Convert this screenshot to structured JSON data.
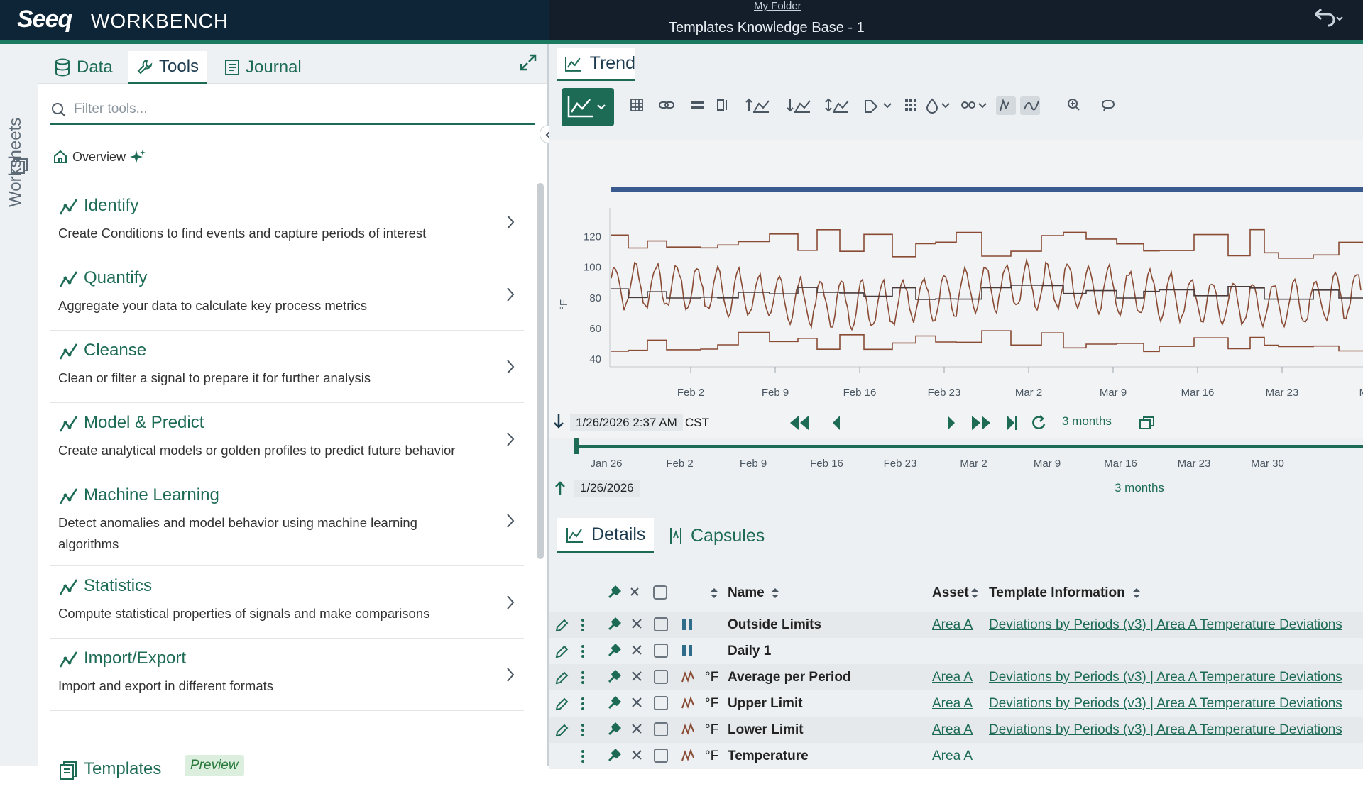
{
  "header": {
    "logo": "Seeq",
    "logo_sub": "WORKBENCH",
    "folder": "My Folder",
    "title": "Templates Knowledge Base - 1"
  },
  "rail": {
    "label": "Worksheets"
  },
  "left_tabs": {
    "data": "Data",
    "tools": "Tools",
    "journal": "Journal"
  },
  "filter": {
    "placeholder": "Filter tools..."
  },
  "overview": "Overview",
  "tools": [
    {
      "title": "Identify",
      "desc": "Create Conditions to find events and capture periods of interest",
      "icon": "identify-icon"
    },
    {
      "title": "Quantify",
      "desc": "Aggregate your data to calculate key process metrics",
      "icon": "quantify-icon"
    },
    {
      "title": "Cleanse",
      "desc": "Clean or filter a signal to prepare it for further analysis",
      "icon": "cleanse-icon"
    },
    {
      "title": "Model & Predict",
      "desc": "Create analytical models or golden profiles to predict future behavior",
      "icon": "model-icon"
    },
    {
      "title": "Machine Learning",
      "desc": "Detect anomalies and model behavior using machine learning algorithms",
      "icon": "ml-icon"
    },
    {
      "title": "Statistics",
      "desc": "Compute statistical properties of signals and make comparisons",
      "icon": "statistics-icon"
    },
    {
      "title": "Import/Export",
      "desc": "Import and export in different formats",
      "icon": "import-export-icon"
    }
  ],
  "templates": {
    "title": "Templates",
    "badge": "Preview"
  },
  "trend_tab": "Trend",
  "chart": {
    "y_unit": "°F",
    "y_ticks": [
      "120",
      "100",
      "80",
      "60",
      "40"
    ],
    "x_ticks": [
      "Feb 2",
      "Feb 9",
      "Feb 16",
      "Feb 23",
      "Mar 2",
      "Mar 9",
      "Mar 16",
      "Mar 23",
      "Ma"
    ]
  },
  "nav": {
    "start": "1/26/2026 2:37 AM",
    "tz": "CST",
    "duration": "3 months"
  },
  "slider": {
    "ticks": [
      "Jan 26",
      "Feb 2",
      "Feb 9",
      "Feb 16",
      "Feb 23",
      "Mar 2",
      "Mar 9",
      "Mar 16",
      "Mar 23",
      "Mar 30"
    ],
    "start": "1/26/2026",
    "duration": "3 months"
  },
  "bottom_tabs": {
    "details": "Details",
    "capsules": "Capsules"
  },
  "grid": {
    "headers": {
      "name": "Name",
      "asset": "Asset",
      "template": "Template Information"
    },
    "rows": [
      {
        "unit": "",
        "name": "Outside Limits",
        "asset": "Area A",
        "template": "Deviations by Periods (v3) | Area A Temperature Deviations",
        "kind": "condition"
      },
      {
        "unit": "",
        "name": "Daily 1",
        "asset": "",
        "template": "",
        "kind": "condition"
      },
      {
        "unit": "°F",
        "name": "Average per Period",
        "asset": "Area A",
        "template": "Deviations by Periods (v3) | Area A Temperature Deviations",
        "kind": "signal"
      },
      {
        "unit": "°F",
        "name": "Upper Limit",
        "asset": "Area A",
        "template": "Deviations by Periods (v3) | Area A Temperature Deviations",
        "kind": "signal"
      },
      {
        "unit": "°F",
        "name": "Lower Limit",
        "asset": "Area A",
        "template": "Deviations by Periods (v3) | Area A Temperature Deviations",
        "kind": "signal"
      },
      {
        "unit": "°F",
        "name": "Temperature",
        "asset": "Area A",
        "template": "",
        "kind": "signal"
      }
    ]
  },
  "colors": {
    "accent": "#1d6b55",
    "header": "#0e2437",
    "signal": "#8a4b34",
    "capsule": "#3a5a8f"
  }
}
